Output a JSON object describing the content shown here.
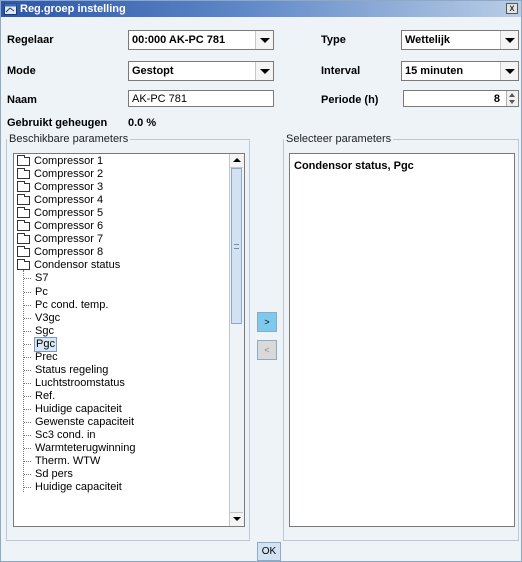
{
  "window": {
    "title": "Reg.groep instelling",
    "close_glyph": "x"
  },
  "form": {
    "regelaar_label": "Regelaar",
    "regelaar_value": "00:000 AK-PC 781",
    "type_label": "Type",
    "type_value": "Wettelijk",
    "mode_label": "Mode",
    "mode_value": "Gestopt",
    "interval_label": "Interval",
    "interval_value": "15 minuten",
    "naam_label": "Naam",
    "naam_value": "AK-PC 781",
    "periode_label": "Periode (h)",
    "periode_value": "8",
    "memory_label": "Gebruikt geheugen",
    "memory_value": "0.0 %"
  },
  "available": {
    "legend": "Beschikbare parameters",
    "folders": [
      "Compressor 1",
      "Compressor 2",
      "Compressor 3",
      "Compressor 4",
      "Compressor 5",
      "Compressor 6",
      "Compressor 7",
      "Compressor 8",
      "Condensor status"
    ],
    "leaves": [
      "S7",
      "Pc",
      "Pc cond. temp.",
      "V3gc",
      "Sgc",
      "Pgc",
      "Prec",
      "Status regeling",
      "Luchtstroomstatus",
      "Ref.",
      "Huidige capaciteit",
      "Gewenste capaciteit",
      "Sc3 cond. in",
      "Warmteterugwinning",
      "Therm. WTW",
      "Sd pers",
      "Huidige capaciteit"
    ],
    "selected_leaf": "Pgc"
  },
  "buttons": {
    "add": ">",
    "remove": "<",
    "ok": "OK"
  },
  "selected": {
    "legend": "Selecteer parameters",
    "items": [
      "Condensor status, Pgc"
    ]
  },
  "colors": {
    "title_gradient_start": "#2c56a8",
    "dialog_background": "#eef3f8",
    "add_button": "#7ec9ee",
    "selection_highlight": "#dbe7f6"
  },
  "icons": {
    "title": "app-window-icon",
    "folder": "folder-icon",
    "dropdown": "chevron-down-icon"
  }
}
